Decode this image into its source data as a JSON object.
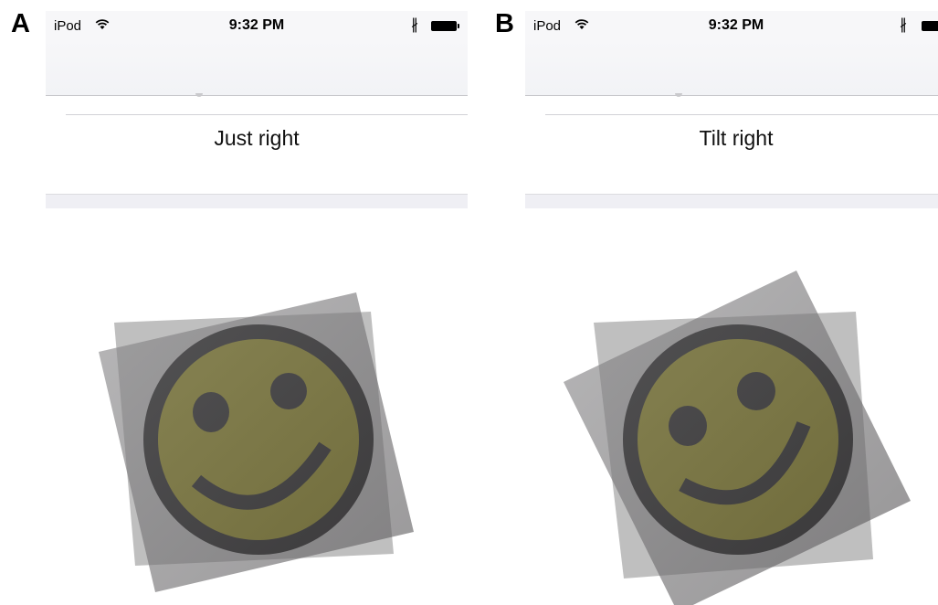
{
  "panels": [
    {
      "letter": "A",
      "status": {
        "carrier": "iPod",
        "time": "9:32 PM"
      },
      "picker": {
        "selected": "Just right"
      },
      "icon": "smiley-face-icon"
    },
    {
      "letter": "B",
      "status": {
        "carrier": "iPod",
        "time": "9:32 PM"
      },
      "picker": {
        "selected": "Tilt right"
      },
      "icon": "smiley-face-icon"
    }
  ],
  "colors": {
    "smiley_fill": "#8a8200",
    "overlay_gray": "#6f6d6f",
    "light_gray": "#bdbdbd",
    "outline": "#000000"
  }
}
